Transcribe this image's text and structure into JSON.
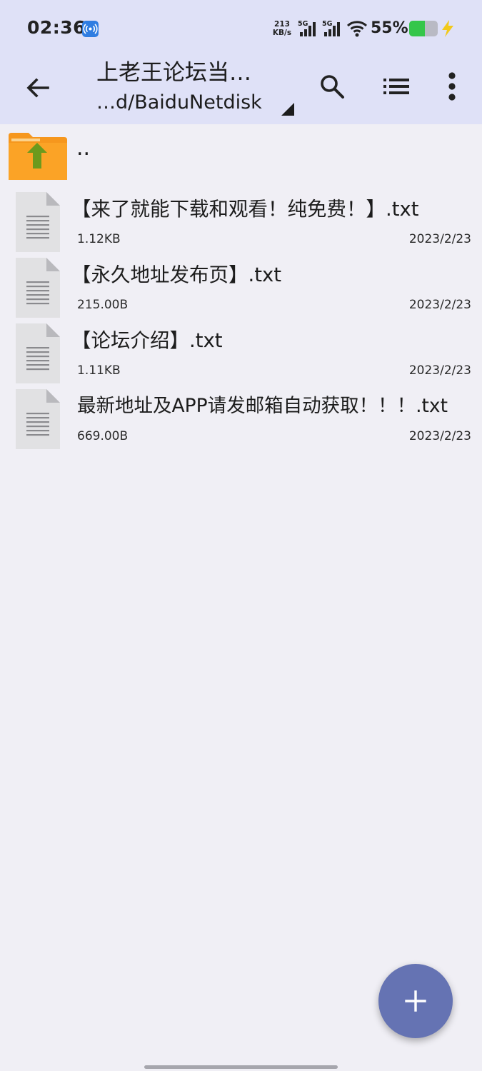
{
  "status_bar": {
    "time": "02:36",
    "net_speed_value": "213",
    "net_speed_unit": "KB/s",
    "signal_1_label": "5G",
    "signal_2_label": "5G",
    "battery_percent": "55%",
    "battery_level": 0.55,
    "icons": [
      "hotspot-icon",
      "signal-icon",
      "wifi-icon",
      "battery-icon",
      "bolt-icon"
    ]
  },
  "toolbar": {
    "title": "上老王论坛当…",
    "subtitle": "…d/BaiduNetdisk",
    "icons": [
      "back-arrow-icon",
      "search-icon",
      "list-view-icon",
      "more-vert-icon",
      "dropdown-triangle-icon"
    ]
  },
  "file_list": {
    "parent_label": "..",
    "files": [
      {
        "name": "【来了就能下载和观看！纯免费！】.txt",
        "size": "1.12KB",
        "date": "2023/2/23"
      },
      {
        "name": "【永久地址发布页】.txt",
        "size": "215.00B",
        "date": "2023/2/23"
      },
      {
        "name": "【论坛介绍】.txt",
        "size": "1.11KB",
        "date": "2023/2/23"
      },
      {
        "name": "最新地址及APP请发邮箱自动获取！！！.txt",
        "size": "669.00B",
        "date": "2023/2/23"
      }
    ]
  },
  "fab": {
    "icon": "plus-icon"
  },
  "colors": {
    "header_bg": "#dfe1f7",
    "list_bg": "#f0eff5",
    "fab_bg": "#6573b3",
    "folder_orange": "#f6971d",
    "arrow_green": "#6c9a1d",
    "battery_green": "#35c64a",
    "bolt_yellow": "#f2c91b"
  }
}
